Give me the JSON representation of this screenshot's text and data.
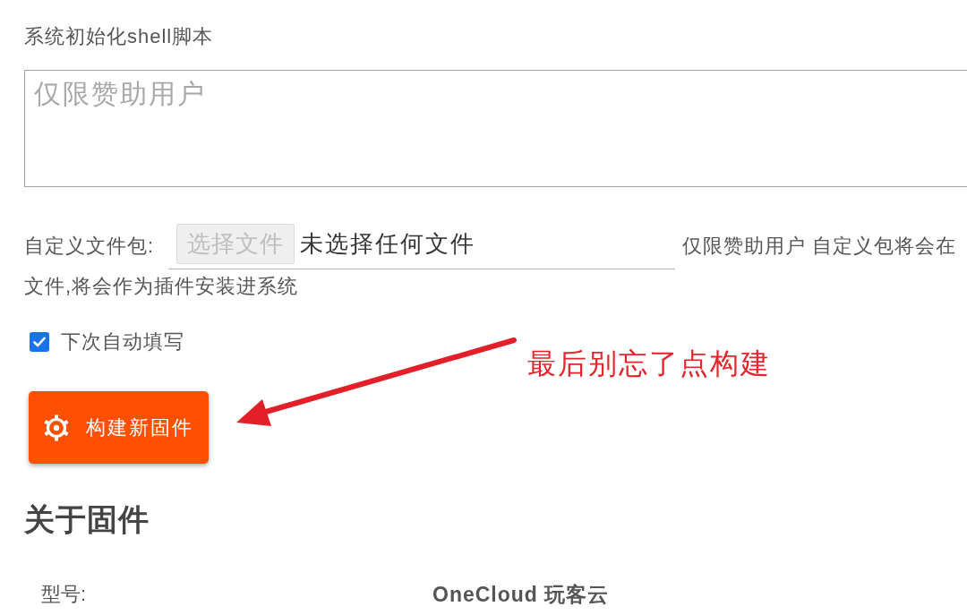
{
  "shell_script": {
    "label": "系统初始化shell脚本",
    "placeholder": "仅限赞助用户"
  },
  "custom_package": {
    "label": "自定义文件包:",
    "button": "选择文件",
    "disabled": true,
    "file_status": "未选择任何文件",
    "note_lines": [
      "仅限赞助用户 自定义包将会在",
      "文件,将会作为插件安装进系统"
    ]
  },
  "auto_fill": {
    "label": "下次自动填写",
    "checked": true
  },
  "build_button": {
    "label": "构建新固件"
  },
  "annotation": {
    "text": "最后别忘了点构建"
  },
  "about": {
    "title": "关于固件",
    "rows": [
      {
        "label": "型号:",
        "value": "OneCloud 玩客云"
      }
    ]
  }
}
